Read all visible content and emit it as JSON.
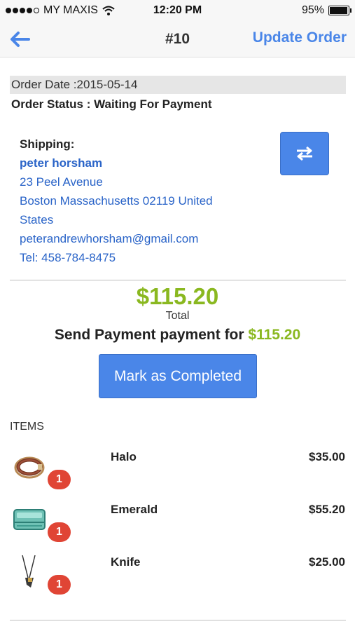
{
  "status_bar": {
    "carrier": "MY MAXIS",
    "time": "12:20 PM",
    "battery": "95%",
    "battery_level": 0.95
  },
  "nav": {
    "title": "#10",
    "action_label": "Update Order",
    "back_icon": "arrow-left-icon"
  },
  "order": {
    "date_text": "Order Date :2015-05-14",
    "status_text": "Order Status : Waiting For Payment"
  },
  "shipping": {
    "label": "Shipping:",
    "name": "peter horsham",
    "street": "23 Peel Avenue",
    "city_line": "Boston Massachusetts 02119 United",
    "country_line": "States",
    "email": "peterandrewhorsham@gmail.com",
    "phone": "Tel: 458-784-8475",
    "swap_icon": "swap-arrows-icon"
  },
  "summary": {
    "total": "$115.20",
    "total_label": "Total",
    "send_prefix": "Send Payment payment for ",
    "send_amount": "$115.20",
    "complete_button": "Mark as Completed"
  },
  "items_header": "ITEMS",
  "items": [
    {
      "name": "Halo",
      "price": "$35.00",
      "qty": "1",
      "thumb": "bracelet-thumbnail"
    },
    {
      "name": "Emerald",
      "price": "$55.20",
      "qty": "1",
      "thumb": "green-stone-thumbnail"
    },
    {
      "name": "Knife",
      "price": "$25.00",
      "qty": "1",
      "thumb": "knife-pendant-thumbnail"
    }
  ],
  "colors": {
    "accent_blue": "#4a86e8",
    "link_blue": "#2a64c8",
    "price_green": "#8ab820",
    "badge_red": "#e04535"
  }
}
